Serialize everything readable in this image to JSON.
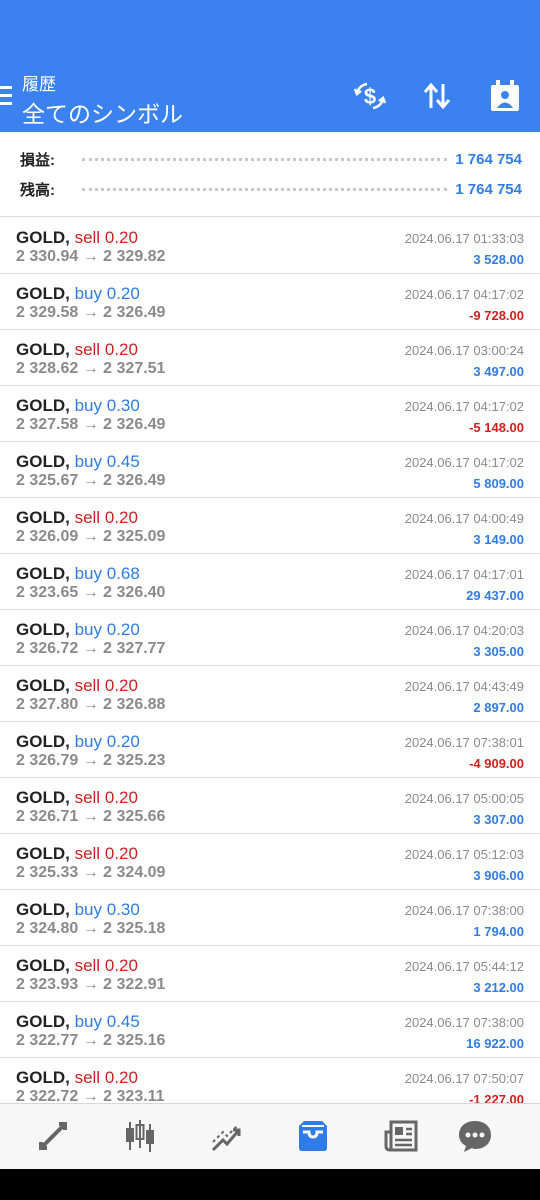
{
  "header": {
    "subtitle": "履歴",
    "title": "全てのシンボル",
    "icons": [
      "menu-icon",
      "currency-exchange-icon",
      "sort-icon",
      "calendar-icon"
    ],
    "color": "#3b82f0"
  },
  "summary": {
    "profit_label": "損益:",
    "profit_value": "1 764 754",
    "balance_label": "残高:",
    "balance_value": "1 764 754"
  },
  "trades": [
    {
      "symbol": "GOLD,",
      "side": "sell",
      "volume": "0.20",
      "open": "2 330.94",
      "close": "2 329.82",
      "time": "2024.06.17 01:33:03",
      "profit": "3 528.00"
    },
    {
      "symbol": "GOLD,",
      "side": "buy",
      "volume": "0.20",
      "open": "2 329.58",
      "close": "2 326.49",
      "time": "2024.06.17 04:17:02",
      "profit": "-9 728.00"
    },
    {
      "symbol": "GOLD,",
      "side": "sell",
      "volume": "0.20",
      "open": "2 328.62",
      "close": "2 327.51",
      "time": "2024.06.17 03:00:24",
      "profit": "3 497.00"
    },
    {
      "symbol": "GOLD,",
      "side": "buy",
      "volume": "0.30",
      "open": "2 327.58",
      "close": "2 326.49",
      "time": "2024.06.17 04:17:02",
      "profit": "-5 148.00"
    },
    {
      "symbol": "GOLD,",
      "side": "buy",
      "volume": "0.45",
      "open": "2 325.67",
      "close": "2 326.49",
      "time": "2024.06.17 04:17:02",
      "profit": "5 809.00"
    },
    {
      "symbol": "GOLD,",
      "side": "sell",
      "volume": "0.20",
      "open": "2 326.09",
      "close": "2 325.09",
      "time": "2024.06.17 04:00:49",
      "profit": "3 149.00"
    },
    {
      "symbol": "GOLD,",
      "side": "buy",
      "volume": "0.68",
      "open": "2 323.65",
      "close": "2 326.40",
      "time": "2024.06.17 04:17:01",
      "profit": "29 437.00"
    },
    {
      "symbol": "GOLD,",
      "side": "buy",
      "volume": "0.20",
      "open": "2 326.72",
      "close": "2 327.77",
      "time": "2024.06.17 04:20:03",
      "profit": "3 305.00"
    },
    {
      "symbol": "GOLD,",
      "side": "sell",
      "volume": "0.20",
      "open": "2 327.80",
      "close": "2 326.88",
      "time": "2024.06.17 04:43:49",
      "profit": "2 897.00"
    },
    {
      "symbol": "GOLD,",
      "side": "buy",
      "volume": "0.20",
      "open": "2 326.79",
      "close": "2 325.23",
      "time": "2024.06.17 07:38:01",
      "profit": "-4 909.00"
    },
    {
      "symbol": "GOLD,",
      "side": "sell",
      "volume": "0.20",
      "open": "2 326.71",
      "close": "2 325.66",
      "time": "2024.06.17 05:00:05",
      "profit": "3 307.00"
    },
    {
      "symbol": "GOLD,",
      "side": "sell",
      "volume": "0.20",
      "open": "2 325.33",
      "close": "2 324.09",
      "time": "2024.06.17 05:12:03",
      "profit": "3 906.00"
    },
    {
      "symbol": "GOLD,",
      "side": "buy",
      "volume": "0.30",
      "open": "2 324.80",
      "close": "2 325.18",
      "time": "2024.06.17 07:38:00",
      "profit": "1 794.00"
    },
    {
      "symbol": "GOLD,",
      "side": "sell",
      "volume": "0.20",
      "open": "2 323.93",
      "close": "2 322.91",
      "time": "2024.06.17 05:44:12",
      "profit": "3 212.00"
    },
    {
      "symbol": "GOLD,",
      "side": "buy",
      "volume": "0.45",
      "open": "2 322.77",
      "close": "2 325.16",
      "time": "2024.06.17 07:38:00",
      "profit": "16 922.00"
    },
    {
      "symbol": "GOLD,",
      "side": "sell",
      "volume": "0.20",
      "open": "2 322.72",
      "close": "2 323.11",
      "time": "2024.06.17 07:50:07",
      "profit": "-1 227.00"
    }
  ],
  "bottom_nav": {
    "items": [
      "quotes-icon",
      "chart-icon",
      "trade-icon",
      "history-icon",
      "news-icon",
      "messages-icon"
    ],
    "active": "history-icon"
  }
}
